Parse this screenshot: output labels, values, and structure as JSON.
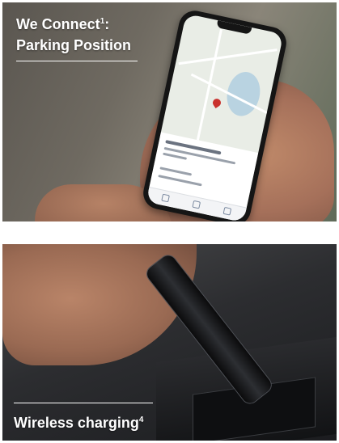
{
  "top_panel": {
    "title_line1": "We Connect",
    "title_sup": "1",
    "title_suffix": ":",
    "title_line2": "Parking Position"
  },
  "bottom_panel": {
    "title": "Wireless charging",
    "title_sup": "4"
  }
}
